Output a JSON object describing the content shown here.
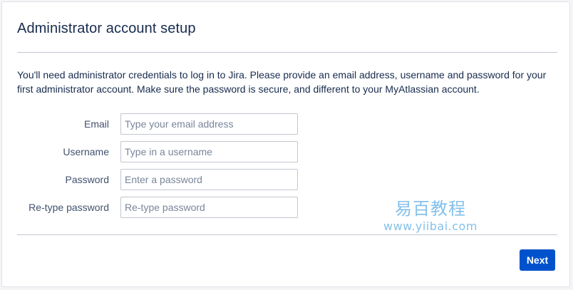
{
  "page": {
    "title": "Administrator account setup",
    "intro": "You'll need administrator credentials to log in to Jira. Please provide an email address, username and password for your first administrator account. Make sure the password is secure, and different to your MyAtlassian account."
  },
  "form": {
    "email": {
      "label": "Email",
      "value": "",
      "placeholder": "Type your email address"
    },
    "username": {
      "label": "Username",
      "value": "",
      "placeholder": "Type in a username"
    },
    "password": {
      "label": "Password",
      "value": "",
      "placeholder": "Enter a password"
    },
    "retype_password": {
      "label": "Re-type password",
      "value": "",
      "placeholder": "Re-type password"
    }
  },
  "actions": {
    "next_label": "Next"
  },
  "watermark": {
    "text": "易百教程",
    "url": "www.yiibai.com"
  },
  "colors": {
    "primary_button": "#0052cc",
    "text": "#172b4d",
    "label": "#42526e",
    "border": "#c1c7d0"
  }
}
